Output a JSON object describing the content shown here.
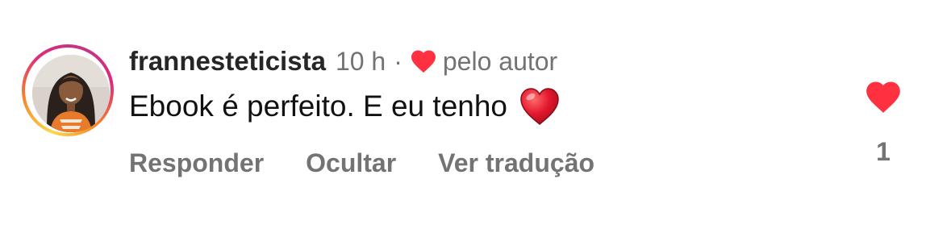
{
  "comment": {
    "username": "frannesteticista",
    "time": "10 h",
    "separator": "·",
    "liked_by_author_label": "pelo autor",
    "text": "Ebook é perfeito. E eu tenho",
    "emoji": "red-heart-emoji",
    "actions": {
      "reply": "Responder",
      "hide": "Ocultar",
      "translate": "Ver tradução"
    },
    "like_count": "1",
    "liked": true
  },
  "colors": {
    "like_red": "#ff3040",
    "text_primary": "#262626",
    "text_secondary": "#737373",
    "story_ring": [
      "#fdd74a",
      "#f58529",
      "#dd2a7b",
      "#c13584"
    ]
  }
}
